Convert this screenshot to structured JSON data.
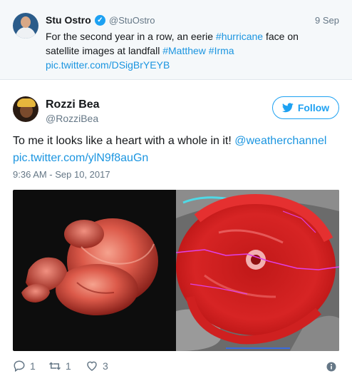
{
  "quoted_tweet": {
    "name": "Stu Ostro",
    "handle": "@StuOstro",
    "date": "9 Sep",
    "text_before_hashtag": "For the second year in a row, an eerie ",
    "hashtag_hurricane": "#hurricane",
    "text_middle": " face on satellite images at landfall ",
    "hashtag_matthew": "#Matthew",
    "hashtag_irma": "#Irma",
    "pic_link": "pic.twitter.com/DSigBrYEYB"
  },
  "tweet": {
    "name": "Rozzi Bea",
    "handle": "@RozziBea",
    "follow_label": "Follow",
    "text": "To me it looks like a heart with a whole in it! ",
    "mention": "@weatherchannel",
    "pic_link": "pic.twitter.com/ylN9f8auGn",
    "timestamp": "9:36 AM - Sep 10, 2017"
  },
  "actions": {
    "reply_count": "1",
    "retweet_count": "1",
    "like_count": "3"
  },
  "colors": {
    "link": "#1b95e0",
    "accent": "#1da1f2",
    "secondary_text": "#657786",
    "quoted_background": "#f5f8fa"
  }
}
